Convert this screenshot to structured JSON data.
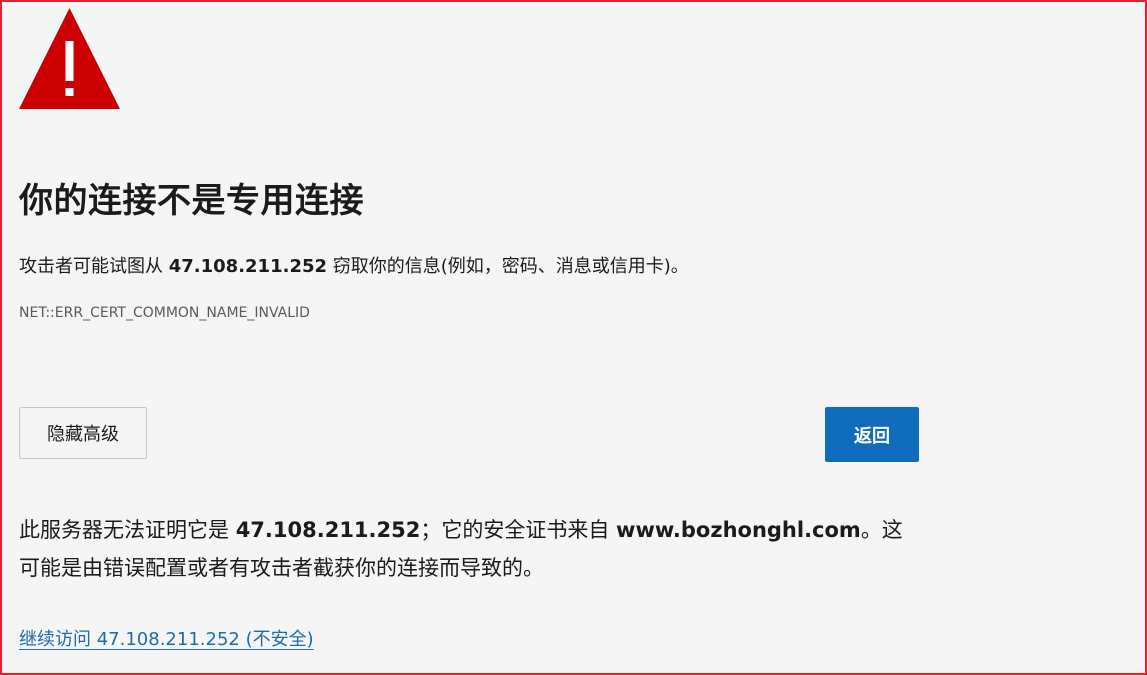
{
  "title": "你的连接不是专用连接",
  "description": {
    "prefix": "攻击者可能试图从 ",
    "ip": "47.108.211.252",
    "suffix": " 窃取你的信息(例如，密码、消息或信用卡)。"
  },
  "error_code": "NET::ERR_CERT_COMMON_NAME_INVALID",
  "buttons": {
    "advanced_label": "隐藏高级",
    "back_label": "返回"
  },
  "explanation": {
    "part1": "此服务器无法证明它是 ",
    "ip": "47.108.211.252",
    "part2": "；它的安全证书来自 ",
    "host": "www.bozhonghl.com",
    "part3": "。这可能是由错误配置或者有攻击者截获你的连接而导致的。"
  },
  "proceed_link": "继续访问 47.108.211.252 (不安全)",
  "colors": {
    "warning_red": "#cc0000",
    "frame_red": "#e3232c",
    "primary_blue": "#0f6cbd",
    "link_blue": "#1e6aae",
    "background": "#f5f5f5"
  },
  "icons": {
    "warning": "warning-triangle-icon"
  }
}
